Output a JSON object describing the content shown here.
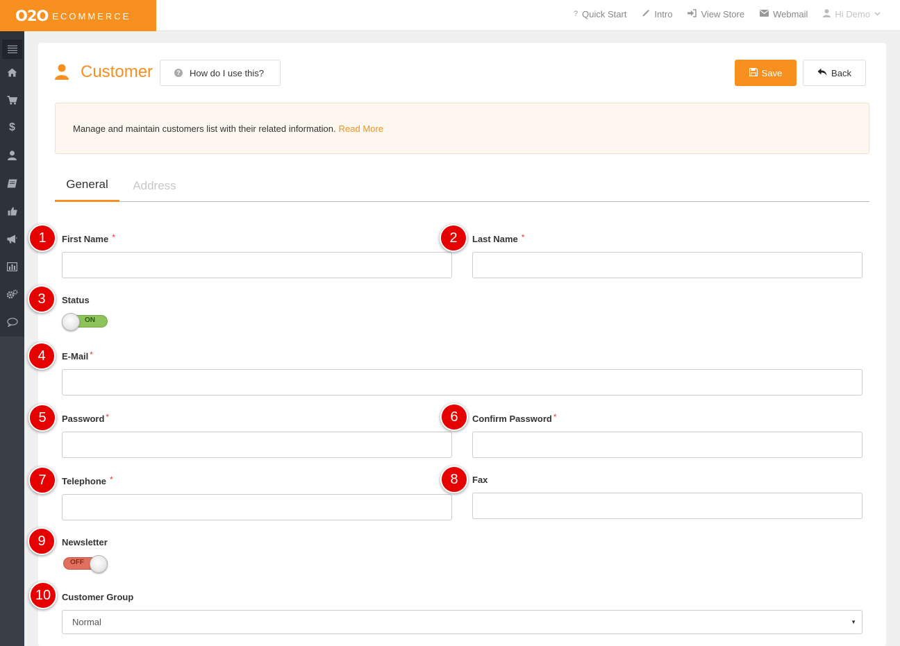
{
  "brand": {
    "mark": "O2O",
    "name": "ECOMMERCE",
    "accent": "#f7901e"
  },
  "topnav": {
    "items": [
      {
        "icon": "question-icon",
        "label": "Quick Start"
      },
      {
        "icon": "magic-wand-icon",
        "label": "Intro"
      },
      {
        "icon": "sign-in-icon",
        "label": "View Store"
      },
      {
        "icon": "envelope-icon",
        "label": "Webmail"
      }
    ],
    "user": {
      "icon": "user-icon",
      "label": "Hi Demo"
    }
  },
  "sidebar": {
    "items": [
      {
        "icon": "menu-icon"
      },
      {
        "icon": "home-icon"
      },
      {
        "icon": "cart-icon"
      },
      {
        "icon": "dollar-icon"
      },
      {
        "icon": "user-icon"
      },
      {
        "icon": "book-icon"
      },
      {
        "icon": "thumbs-up-icon"
      },
      {
        "icon": "megaphone-icon"
      },
      {
        "icon": "bar-chart-icon"
      },
      {
        "icon": "gears-icon"
      },
      {
        "icon": "chat-bubble-icon"
      }
    ]
  },
  "header": {
    "title": "Customer",
    "help_label": "How do I use this?",
    "save_label": "Save",
    "back_label": "Back"
  },
  "info": {
    "text": "Manage and maintain customers list with their related information.",
    "read_more": "Read More"
  },
  "tabs": [
    {
      "label": "General",
      "active": true
    },
    {
      "label": "Address",
      "active": false
    }
  ],
  "form": {
    "first_name": {
      "label": "First Name",
      "value": ""
    },
    "last_name": {
      "label": "Last Name",
      "value": ""
    },
    "status": {
      "label": "Status",
      "state": "ON"
    },
    "email": {
      "label": "E-Mail",
      "value": ""
    },
    "password": {
      "label": "Password",
      "value": ""
    },
    "confirm_password": {
      "label": "Confirm Password",
      "value": ""
    },
    "telephone": {
      "label": "Telephone",
      "value": ""
    },
    "fax": {
      "label": "Fax",
      "value": ""
    },
    "newsletter": {
      "label": "Newsletter",
      "state": "OFF"
    },
    "customer_group": {
      "label": "Customer Group",
      "value": "Normal"
    },
    "required_mark": "*"
  },
  "markers": [
    "1",
    "2",
    "3",
    "4",
    "5",
    "6",
    "7",
    "8",
    "9",
    "10"
  ]
}
